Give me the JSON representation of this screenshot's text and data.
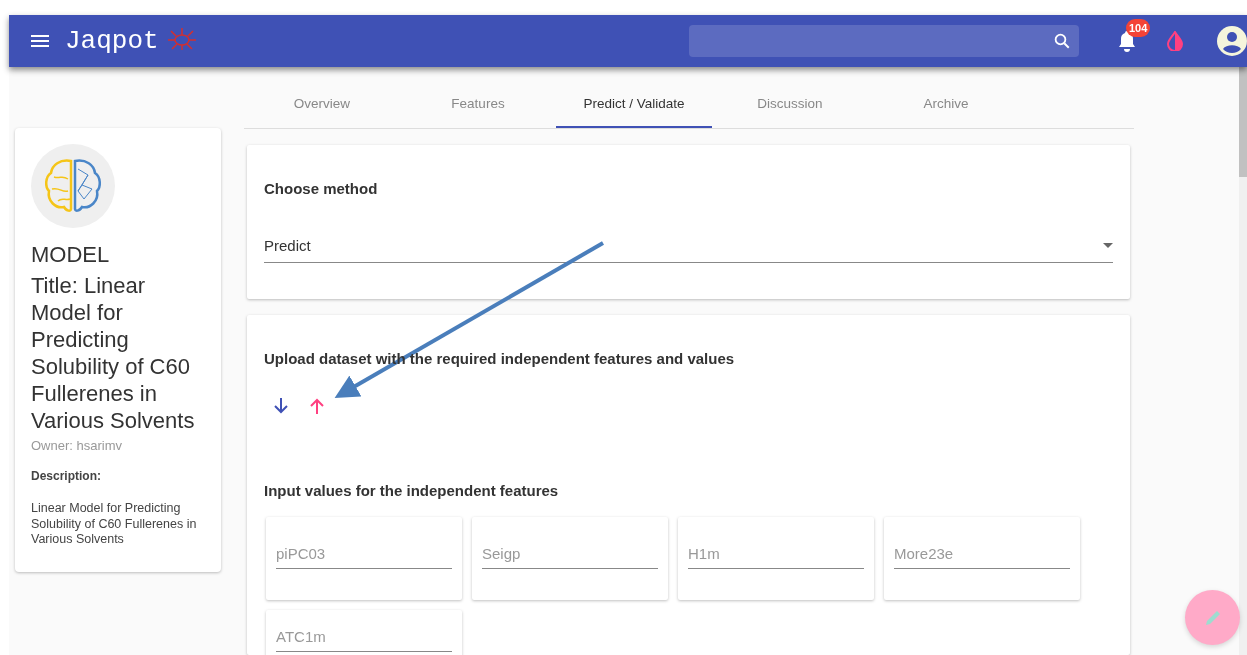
{
  "app_bar": {
    "title": "Jaqpot",
    "notifications": {
      "badge": "104"
    }
  },
  "tabs": [
    {
      "label": "Overview",
      "selected": false
    },
    {
      "label": "Features",
      "selected": false
    },
    {
      "label": "Predict / Validate",
      "selected": true
    },
    {
      "label": "Discussion",
      "selected": false
    },
    {
      "label": "Archive",
      "selected": false
    }
  ],
  "model_card": {
    "heading": "MODEL",
    "title": "Title: Linear Model for Predicting Solubility of C60 Fullerenes in Various Solvents",
    "owner": "Owner: hsarimv",
    "description_label": "Description:",
    "description": "Linear Model for Predicting Solubility of C60 Fullerenes in Various Solvents"
  },
  "method": {
    "heading": "Choose method",
    "value": "Predict"
  },
  "upload": {
    "heading": "Upload dataset with the required independent features and values"
  },
  "inputs": {
    "heading": "Input values for the independent features",
    "fields": [
      {
        "placeholder": "piPC03"
      },
      {
        "placeholder": "Seigp"
      },
      {
        "placeholder": "H1m"
      },
      {
        "placeholder": "More23e"
      },
      {
        "placeholder": "ATC1m"
      }
    ]
  }
}
